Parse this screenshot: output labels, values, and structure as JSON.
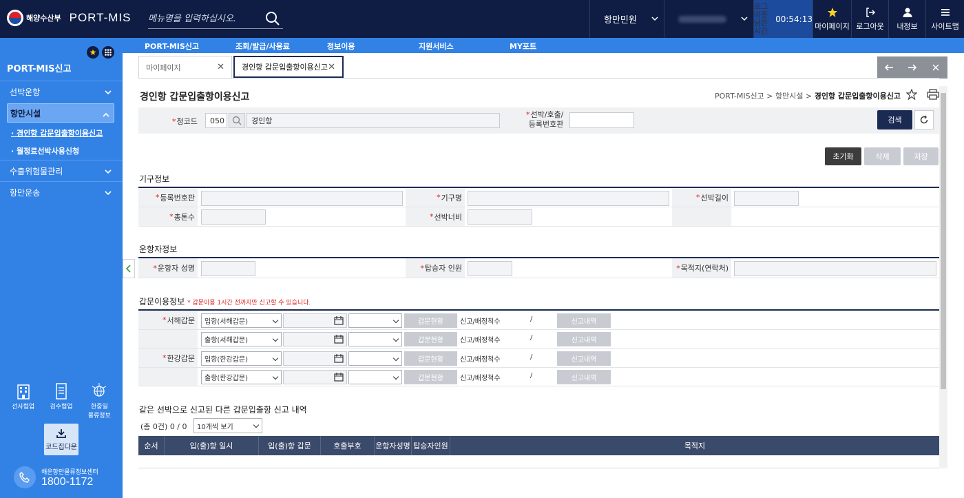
{
  "header": {
    "org_name": "해양수산부",
    "app_name": "PORT-MIS",
    "search_placeholder": "메뉴명을 입력하십시오.",
    "service_select": "항만민원",
    "user_select": "",
    "logout_timer_label_1": "로그아웃",
    "logout_timer_label_2": "남은시간",
    "logout_timer_value": "00:54:13",
    "mypage_label": "마이페이지",
    "logout_label": "로그아웃",
    "myinfo_label": "내정보",
    "sitemap_label": "사이트맵"
  },
  "gnb": [
    "PORT-MIS신고",
    "조회/발급/사용료",
    "정보이용",
    "지원서비스",
    "MY포트"
  ],
  "sidebar": {
    "title": "PORT-MIS신고",
    "items": [
      {
        "label": "선박운항"
      },
      {
        "label": "항만시설"
      },
      {
        "label": "경인항 갑문입출항이용신고"
      },
      {
        "label": "월정료선박사용신청"
      },
      {
        "label": "수출위험물관리"
      },
      {
        "label": "항만운송"
      }
    ],
    "quick": [
      {
        "label": "선사협업"
      },
      {
        "label": "검수협업"
      },
      {
        "label": "한중일\n물류정보"
      }
    ],
    "code_download": "코드집다운",
    "call_center_name": "해운항만물류정보센터",
    "call_center_number": "1800-1172"
  },
  "tabs": [
    {
      "label": "마이페이지"
    },
    {
      "label": "경인항 갑문입출항이용신고"
    }
  ],
  "page": {
    "title": "경인항 갑문입출항이용신고",
    "breadcrumb_1": "PORT-MIS신고",
    "breadcrumb_2": "항만시설",
    "breadcrumb_3": "경인항 갑문입출항이용신고",
    "sep": ">"
  },
  "search": {
    "office_label": "청코드",
    "office_code": "050",
    "office_name": "경인항",
    "ship_label_1": "선박/호출/",
    "ship_label_2": "등록번호판",
    "search_btn": "검색"
  },
  "actions": {
    "reset": "초기화",
    "delete": "삭제",
    "save": "저장"
  },
  "section_gigu": {
    "title": "기구정보",
    "reg_no": "등록번호판",
    "gigu_name": "기구명",
    "ship_length": "선박길이",
    "tonnage": "총톤수",
    "ship_width": "선박너비"
  },
  "section_operator": {
    "title": "운항자정보",
    "operator_name": "운항자 성명",
    "passengers": "탑승자 인원",
    "destination": "목적지(연락처)"
  },
  "section_gate": {
    "title": "갑문이용정보",
    "notice": "* 갑문이용 1시간 전까지만 신고할 수 있습니다.",
    "west_gate": "서해갑문",
    "han_gate": "한강갑문",
    "rows": [
      {
        "type": "입항(서해갑문)"
      },
      {
        "type": "출항(서해갑문)"
      },
      {
        "type": "입항(한강갑문)"
      },
      {
        "type": "출항(한강갑문)"
      }
    ],
    "status_btn": "갑문현황",
    "count_label": "신고/배정척수",
    "slash": "/",
    "history_btn": "신고내역"
  },
  "list": {
    "title": "같은 선박으로 신고된 다른 갑문입출항 신고 내역",
    "count": "(총 0건) 0 / 0",
    "page_size": "10개씩 보기",
    "columns": [
      "순서",
      "입(출)항 일시",
      "입(출)항 갑문",
      "호출부호",
      "운항자성명",
      "탑승자인원",
      "목적지"
    ]
  }
}
